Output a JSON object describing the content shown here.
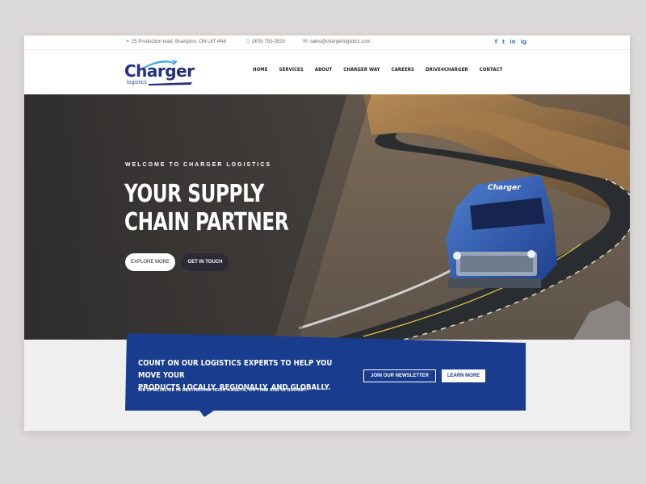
{
  "topbar": {
    "address": "25 Production road, Brampton, ON L6T 4N8",
    "phone": "(905) 793-3525",
    "email": "sales@chargerlogistics.com",
    "social": [
      "f",
      "t",
      "in",
      "ig"
    ]
  },
  "logo": {
    "name": "Charger",
    "sub": "logistics"
  },
  "nav": [
    "HOME",
    "SERVICES",
    "ABOUT",
    "CHARGER WAY",
    "CAREERS",
    "DRIVE4CHARGER",
    "CONTACT"
  ],
  "hero": {
    "eyebrow": "WELCOME TO CHARGER LOGISTICS",
    "line1": "YOUR SUPPLY",
    "line2": "CHAIN PARTNER",
    "btn_explore": "EXPLORE MORE",
    "btn_touch": "GET IN TOUCH",
    "truck_brand": "Charger"
  },
  "cta": {
    "line1": "COUNT ON OUR LOGISTICS EXPERTS TO HELP YOU MOVE YOUR",
    "line2": "PRODUCTS LOCALLY, REGIONALLY, AND GLOBALLY.",
    "sub": "WE SPECIALIZE IN DELIVERING YOUR ASSETS, ON TIME AND IN BUDGET.",
    "btn_newsletter": "JOIN OUR NEWSLETTER",
    "btn_learn": "LEARN MORE"
  },
  "colors": {
    "brand_blue": "#1a3c8e",
    "dark": "#2b2a36",
    "accent_icon": "#4a8fd9"
  }
}
